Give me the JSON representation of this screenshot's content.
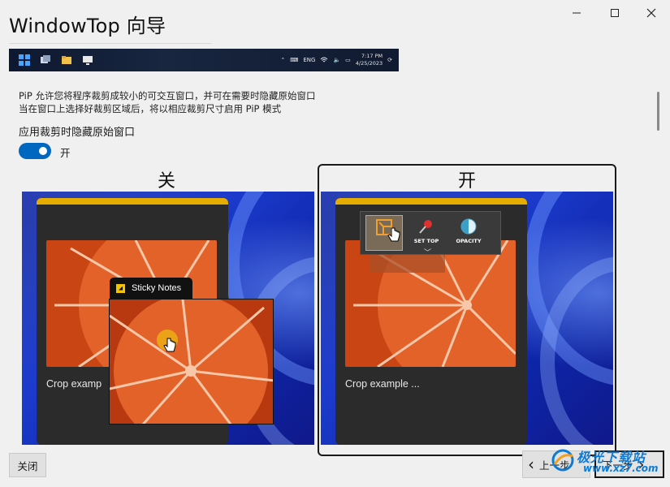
{
  "window": {
    "title": "WindowTop 向导",
    "minimize_glyph": "—",
    "maximize_glyph": "☐",
    "close_glyph": "✕"
  },
  "taskbar": {
    "lang": "ENG",
    "time": "7:17 PM",
    "date": "4/25/2023"
  },
  "description": {
    "line1": "PiP 允许您将程序裁剪成较小的可交互窗口，并可在需要时隐藏原始窗口",
    "line2": "当在窗口上选择好裁剪区域后，将以相应裁剪尺寸启用 PiP 模式"
  },
  "option": {
    "label": "应用裁剪时隐藏原始窗口",
    "toggle_state": "开",
    "toggle_on": true
  },
  "panels": {
    "off": {
      "heading": "关",
      "card_caption": "Crop examp",
      "sticky_notes_label": "Sticky Notes"
    },
    "on": {
      "heading": "开",
      "card_caption": "Crop example ...",
      "toolbar": {
        "set_top": "SET TOP",
        "opacity": "OPACITY"
      }
    }
  },
  "buttons": {
    "close": "关闭",
    "prev": "上一步",
    "next": "下一步"
  },
  "watermark": {
    "text": "极光下载站",
    "url": "www.xz7.com"
  },
  "colors": {
    "accent": "#0067c0",
    "sticky_yellow": "#e5ad00",
    "orange": "#d9531e"
  }
}
